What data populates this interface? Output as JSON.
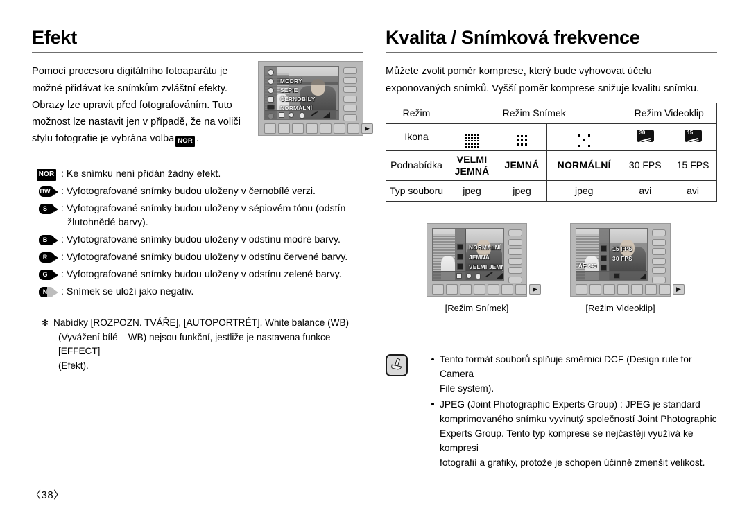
{
  "page": {
    "number": "〈38〉"
  },
  "left": {
    "heading": "Efekt",
    "intro": "Pomocí procesoru digitálního fotoaparátu je možné přidávat ke snímkům zvláštní efekty. Obrazy lze upravit před fotografováním. Tuto možnost lze nastavit jen v případě, že na voliči stylu fotografie je vybrána volba",
    "intro_tail": ".",
    "inline_icon_label": "NOR",
    "legend": [
      {
        "icon": "nor-badge-icon",
        "icon_label": "NOR",
        "text": ": Ke snímku není přidán žádný efekt.",
        "cont": ""
      },
      {
        "icon": "bw-badge-icon",
        "icon_label": "BW",
        "text": ": Vyfotografované snímky budou uloženy v černobílé verzi.",
        "cont": ""
      },
      {
        "icon": "sepia-badge-icon",
        "icon_label": "S",
        "text": ": Vyfotografované snímky budou uloženy v sépiovém tónu (odstín",
        "cont": "žlutohnědé barvy)."
      },
      {
        "icon": "blue-badge-icon",
        "icon_label": "B",
        "text": ": Vyfotografované snímky budou uloženy v odstínu modré barvy.",
        "cont": ""
      },
      {
        "icon": "red-badge-icon",
        "icon_label": "R",
        "text": ": Vyfotografované snímky budou uloženy v odstínu červené barvy.",
        "cont": ""
      },
      {
        "icon": "green-badge-icon",
        "icon_label": "G",
        "text": ": Vyfotografované snímky budou uloženy v odstínu zelené barvy.",
        "cont": ""
      },
      {
        "icon": "negative-badge-icon",
        "icon_label": "N",
        "text": ": Snímek se uloží jako negativ.",
        "cont": ""
      }
    ],
    "note": {
      "star": "✻",
      "line1": "Nabídky [ROZPOZN. TVÁŘE], [AUTOPORTRÉT], White balance (WB)",
      "line2": "(Vyvážení bílé – WB) nejsou funkční, jestliže je nastavena funkce [EFFECT]",
      "line3": "(Efekt)."
    },
    "lcd": {
      "menu": [
        "MODRÝ",
        "SEPIE",
        "ČERNOBÍLÝ",
        "NORMÁLNÍ"
      ]
    }
  },
  "right": {
    "heading": "Kvalita / Snímková frekvence",
    "intro": "Můžete zvolit poměr komprese, který bude vyhovovat účelu exponovaných snímků. Vyšší poměr komprese snižuje kvalitu snímku.",
    "table": {
      "row_labels": [
        "Režim",
        "Ikona",
        "Podnabídka",
        "Typ souboru"
      ],
      "group_headers": [
        "Režim Snímek",
        "Režim Videoklip"
      ],
      "icons": [
        "dots-5x5-icon",
        "dots-3x3-icon",
        "dots-sparse-icon",
        "fps-30-icon",
        "fps-15-icon"
      ],
      "icon_labels": [
        "",
        "",
        "",
        "30",
        "15"
      ],
      "submenu": [
        "VELMI JEMNÁ",
        "JEMNÁ",
        "NORMÁLNÍ",
        "30 FPS",
        "15 FPS"
      ],
      "submenu_line1": [
        "VELMI",
        "JEMNÁ",
        "NORMÁLNÍ",
        "30 FPS",
        "15 FPS"
      ],
      "submenu_line2": [
        "JEMNÁ",
        "",
        "",
        "",
        ""
      ],
      "filetype": [
        "jpeg",
        "jpeg",
        "jpeg",
        "avi",
        "avi"
      ]
    },
    "shots": [
      {
        "caption": "[Režim Snímek]",
        "menu": [
          "NORMÁLNÍ",
          "JEMNÁ",
          "VELMI JEMNÁ"
        ]
      },
      {
        "caption": "[Režim Videoklip]",
        "menu": [
          "15 FPS",
          "30 FPS"
        ],
        "osd": [
          "AF",
          "640"
        ]
      }
    ],
    "note": {
      "icon": "note-pen-icon",
      "bullets": [
        {
          "line1": "Tento formát souborů splňuje směrnici DCF (Design rule for Camera",
          "line2": "File system).",
          "line3": "",
          "line4": ""
        },
        {
          "line1": "JPEG (Joint Photographic Experts Group) : JPEG je standard",
          "line2": "komprimovaného snímku vyvinutý společností Joint Photographic",
          "line3": "Experts Group. Tento typ komprese se nejčastěji využívá ke kompresi",
          "line4": "fotografií a grafiky, protože je schopen účinně zmenšit velikost."
        }
      ]
    }
  },
  "colors": {
    "rule": "#6f6f6f",
    "table_border": "#333333",
    "badge_bg": "#000000"
  }
}
